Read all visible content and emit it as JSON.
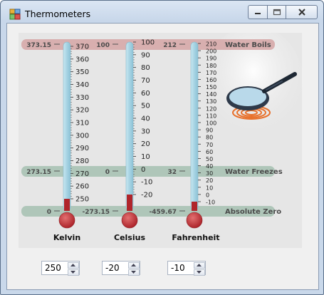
{
  "window": {
    "title": "Thermometers",
    "icon": "thermometer-app-icon",
    "controls": [
      "minimize-icon",
      "maximize-icon",
      "close-icon"
    ]
  },
  "bands": {
    "boils": {
      "label": "Water Boils",
      "kelvin": "373.15",
      "celsius": "100",
      "fahrenheit": "212"
    },
    "freezes": {
      "label": "Water Freezes",
      "kelvin": "273.15",
      "celsius": "0",
      "fahrenheit": "32"
    },
    "absolute": {
      "label": "Absolute Zero",
      "kelvin": "0",
      "celsius": "-273.15",
      "fahrenheit": "-459.67"
    }
  },
  "thermometers": [
    {
      "name": "Kelvin",
      "ticks": [
        "370",
        "360",
        "350",
        "340",
        "330",
        "320",
        "310",
        "300",
        "290",
        "280",
        "270",
        "260",
        "250"
      ],
      "range": [
        245,
        373.15
      ],
      "level": 250
    },
    {
      "name": "Celsius",
      "ticks": [
        "100",
        "90",
        "80",
        "70",
        "60",
        "50",
        "40",
        "30",
        "20",
        "10",
        "0",
        "-10",
        "-20"
      ],
      "range": [
        -28,
        100
      ],
      "level": -20
    },
    {
      "name": "Fahrenheit",
      "ticks": [
        "210",
        "200",
        "190",
        "180",
        "170",
        "160",
        "150",
        "140",
        "130",
        "120",
        "110",
        "100",
        "90",
        "80",
        "70",
        "60",
        "50",
        "40",
        "30",
        "20",
        "10",
        "0",
        "-10"
      ],
      "range": [
        -14,
        212
      ],
      "level": -10
    }
  ],
  "inputs": [
    {
      "value": "250",
      "icon_up": "arrow-up-icon",
      "icon_down": "arrow-down-icon"
    },
    {
      "value": "-20",
      "icon_up": "arrow-up-icon",
      "icon_down": "arrow-down-icon"
    },
    {
      "value": "-10",
      "icon_up": "arrow-up-icon",
      "icon_down": "arrow-down-icon"
    }
  ],
  "colors": {
    "tube": "#a9d6e5",
    "mercury": "#b0252b",
    "boils_band": "#d7a9a9",
    "freezes_band": "#a9c3b6",
    "absolute_band": "#a9c3b6"
  }
}
